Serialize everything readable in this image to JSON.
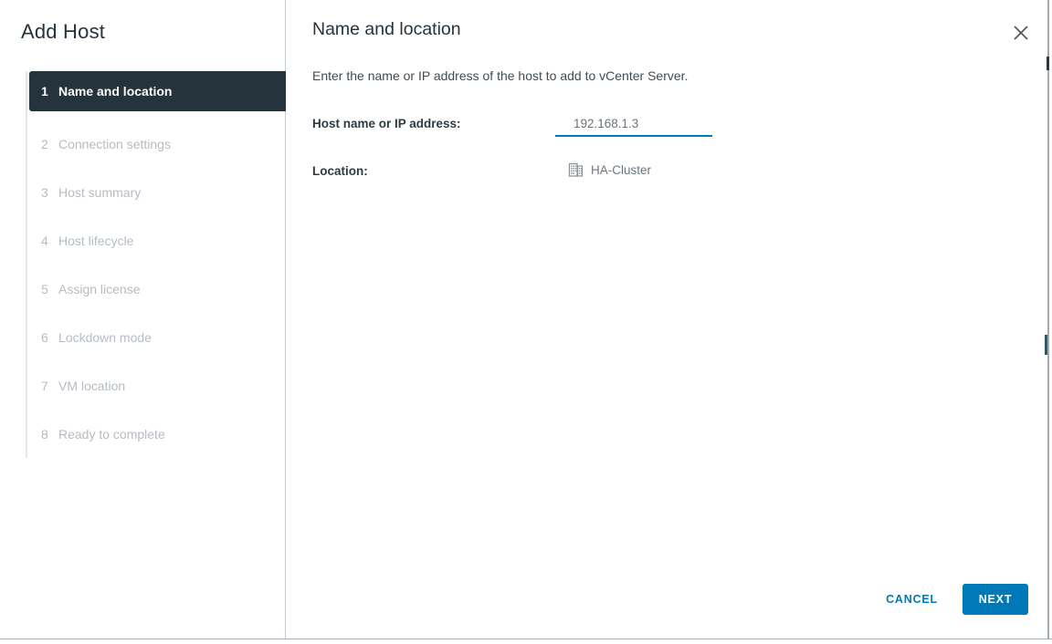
{
  "colors": {
    "accent": "#0079B8",
    "active_step_bg": "#24333C"
  },
  "dialog": {
    "title": "Add Host"
  },
  "steps": [
    {
      "number": "1",
      "label": "Name and location",
      "active": true
    },
    {
      "number": "2",
      "label": "Connection settings",
      "active": false
    },
    {
      "number": "3",
      "label": "Host summary",
      "active": false
    },
    {
      "number": "4",
      "label": "Host lifecycle",
      "active": false
    },
    {
      "number": "5",
      "label": "Assign license",
      "active": false
    },
    {
      "number": "6",
      "label": "Lockdown mode",
      "active": false
    },
    {
      "number": "7",
      "label": "VM location",
      "active": false
    },
    {
      "number": "8",
      "label": "Ready to complete",
      "active": false
    }
  ],
  "content": {
    "heading": "Name and location",
    "description": "Enter the name or IP address of the host to add to vCenter Server.",
    "fields": {
      "host": {
        "label": "Host name or IP address:",
        "value": "192.168.1.3"
      },
      "location": {
        "label": "Location:",
        "value": "HA-Cluster",
        "icon": "cluster-icon"
      }
    }
  },
  "footer": {
    "cancel_label": "CANCEL",
    "next_label": "NEXT"
  }
}
